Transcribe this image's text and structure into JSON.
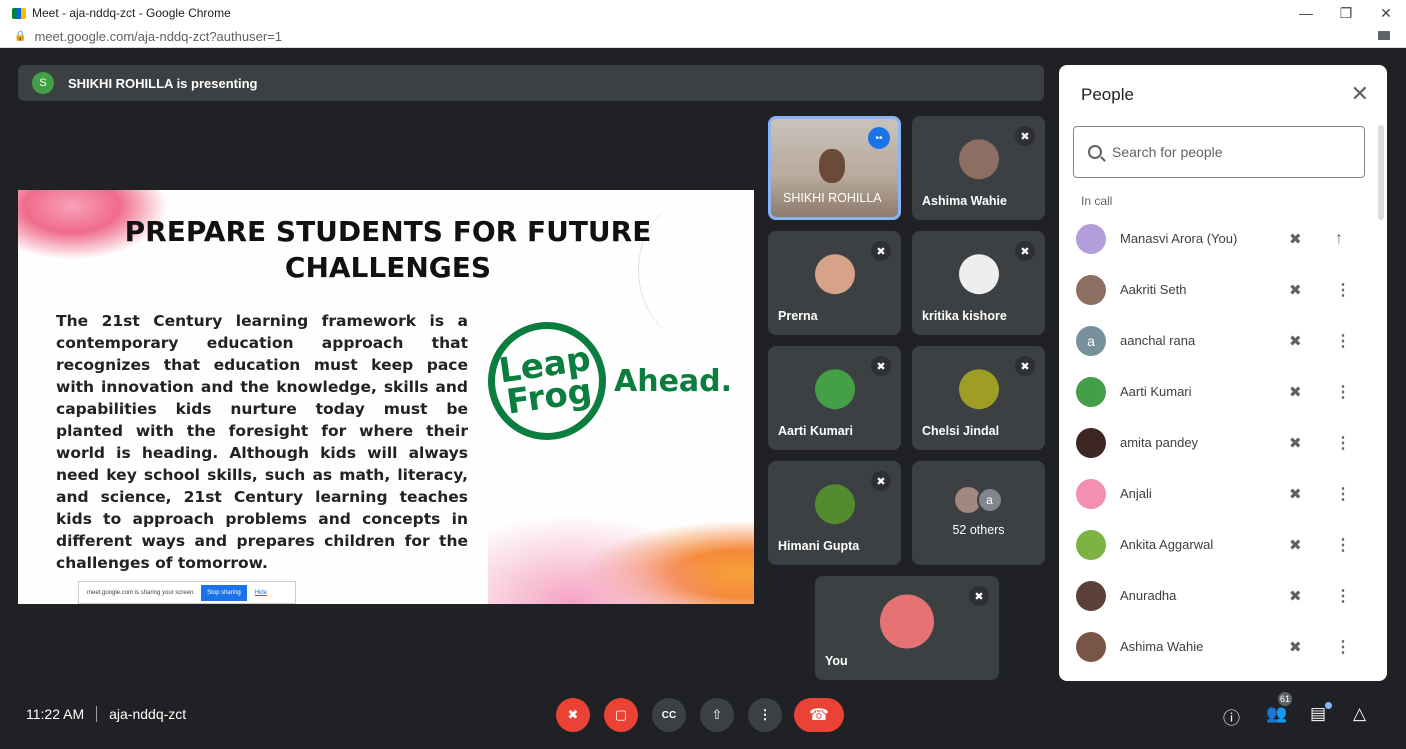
{
  "browser": {
    "window_title": "Meet - aja-nddq-zct - Google Chrome",
    "url": "meet.google.com/aja-nddq-zct?authuser=1",
    "controls": {
      "minimize": "—",
      "restore": "❐",
      "close": "✕"
    }
  },
  "presenting": {
    "avatar_letter": "S",
    "text": "SHIKHI ROHILLA is presenting"
  },
  "slide": {
    "title": "PREPARE STUDENTS FOR FUTURE CHALLENGES",
    "body": "The 21st Century learning framework is a contemporary education approach that recognizes that education must keep pace with innovation and the knowledge, skills and capabilities kids nurture today must be planted with the foresight for where their world is heading. Although kids will always need key school skills, such as math, literacy, and science, 21st Century learning teaches kids to approach problems and concepts in different ways and prepares children for the challenges of tomorrow.",
    "logo_line1": "Leap",
    "logo_line2": "Frog",
    "logo_ahead": "Ahead.",
    "share_notice": "meet.google.com is sharing your screen.",
    "stop_sharing": "Stop sharing",
    "hide": "Hide"
  },
  "tiles": {
    "t1": "SHIKHI ROHILLA",
    "t2": "Ashima Wahie",
    "t3": "Prerna",
    "t4": "kritika kishore",
    "t5": "Aarti Kumari",
    "t6": "Chelsi Jindal",
    "t7": "Himani Gupta",
    "others_letter": "a",
    "others_label": "52 others",
    "you": "You"
  },
  "people": {
    "title": "People",
    "search_placeholder": "Search for people",
    "section": "In call",
    "list": [
      {
        "name": "Manasvi Arora (You)",
        "avatar_color": "#b39ddb",
        "action": "pin-icon"
      },
      {
        "name": "Aakriti Seth",
        "avatar_color": "#8d6e63",
        "action": "more-icon"
      },
      {
        "name": "aanchal rana",
        "avatar_color": "#78909c",
        "letter": "a",
        "action": "more-icon"
      },
      {
        "name": "Aarti Kumari",
        "avatar_color": "#43a047",
        "action": "more-icon"
      },
      {
        "name": "amita pandey",
        "avatar_color": "#3e2723",
        "action": "more-icon"
      },
      {
        "name": "Anjali",
        "avatar_color": "#f48fb1",
        "action": "more-icon"
      },
      {
        "name": "Ankita Aggarwal",
        "avatar_color": "#7cb342",
        "action": "more-icon"
      },
      {
        "name": "Anuradha",
        "avatar_color": "#5d4037",
        "action": "more-icon"
      },
      {
        "name": "Ashima Wahie",
        "avatar_color": "#795548",
        "action": "more-icon"
      }
    ]
  },
  "bottom": {
    "time": "11:22 AM",
    "meeting_code": "aja-nddq-zct",
    "participant_count": "61"
  }
}
